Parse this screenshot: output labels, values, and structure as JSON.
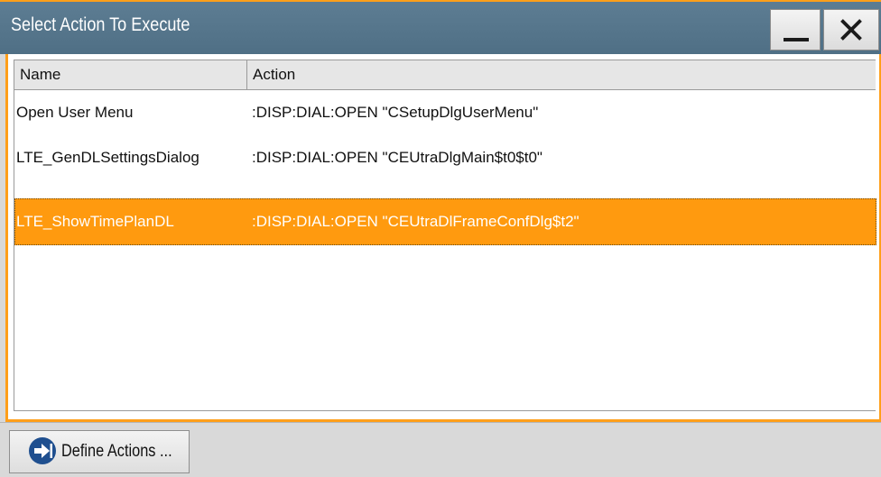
{
  "window": {
    "title": "Select Action To Execute",
    "minimize_icon": "minimize-icon",
    "close_icon": "close-icon"
  },
  "table": {
    "columns": [
      "Name",
      "Action"
    ],
    "rows": [
      {
        "name": "Open User Menu",
        "action": ":DISP:DIAL:OPEN \"CSetupDlgUserMenu\""
      },
      {
        "name": "LTE_GenDLSettingsDialog",
        "action": ":DISP:DIAL:OPEN \"CEUtraDlgMain$t0$t0\""
      },
      {
        "name": "LTE_ShowTimePlanDL",
        "action": ":DISP:DIAL:OPEN \"CEUtraDlFrameConfDlg$t2\""
      }
    ],
    "selected_index": 2
  },
  "footer": {
    "define_actions_label": "Define Actions ...",
    "define_actions_icon": "arrow-right-icon"
  },
  "colors": {
    "accent": "#ff9f1a",
    "titlebar": "#56768c",
    "selection": "#ff9a0f",
    "icon_blue": "#1f4f8f"
  }
}
